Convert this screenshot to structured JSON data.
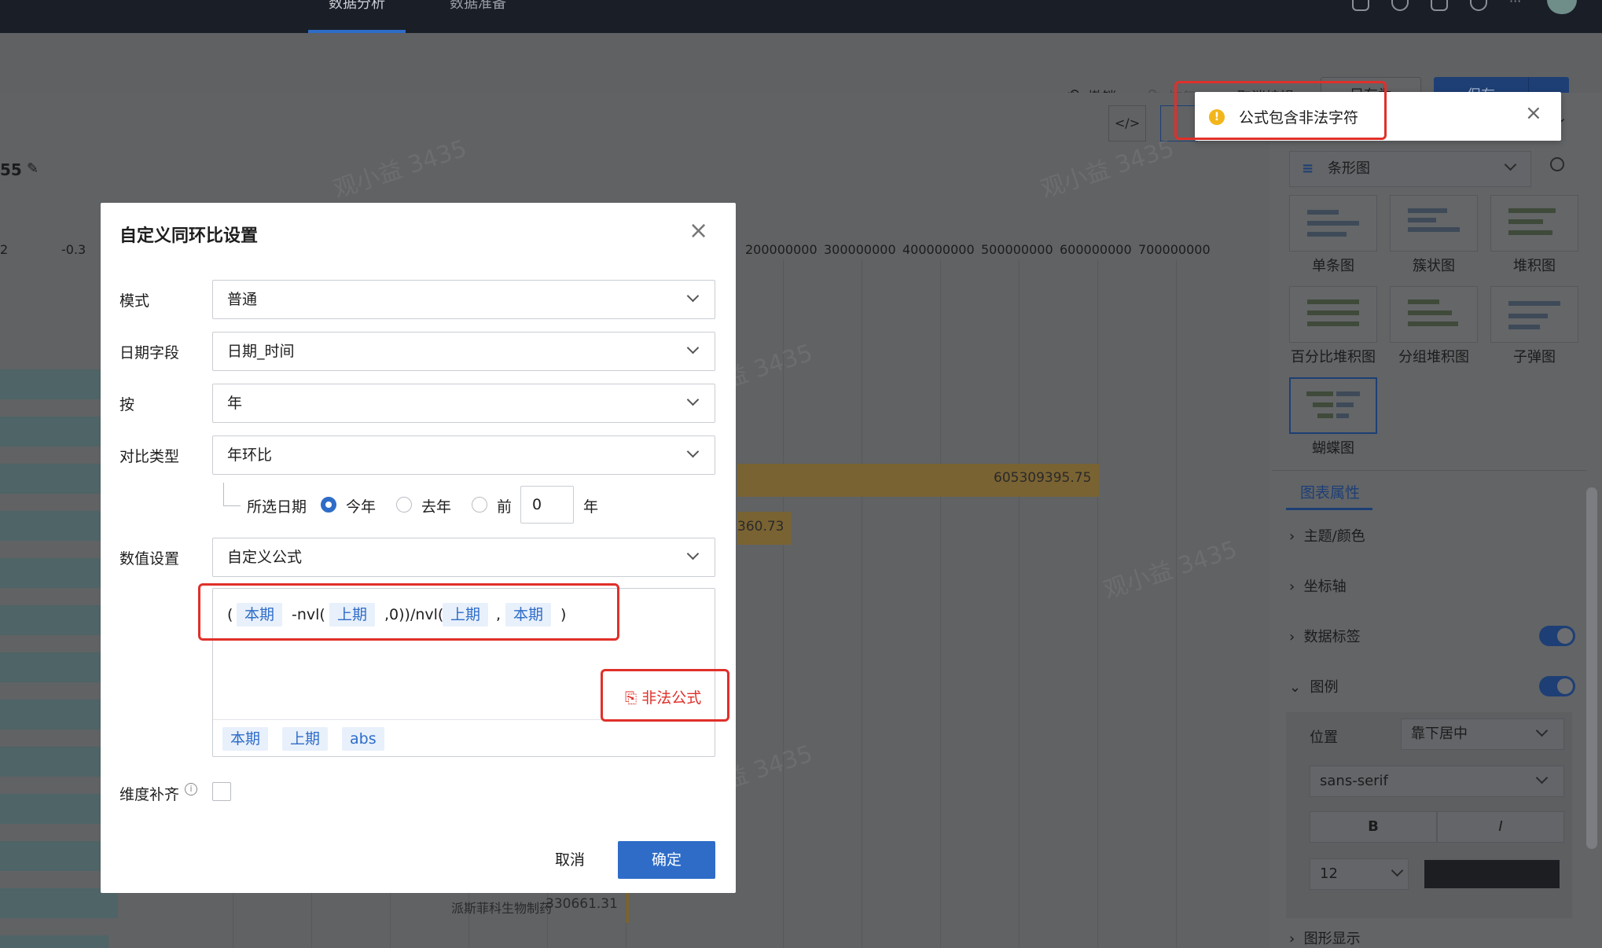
{
  "topbar": {
    "tabs": [
      "数据分析",
      "数据准备"
    ]
  },
  "toolbar": {
    "undo": "撤销",
    "redo": "恢复",
    "cancel_edit": "取消编辑",
    "save_as": "另存为",
    "save": "保存"
  },
  "chart": {
    "left_label": "55",
    "x_ticks": [
      "2",
      "-0.3",
      "200000000",
      "300000000",
      "400000000",
      "500000000",
      "600000000",
      "700000000"
    ],
    "bar_labels": [
      "605309395.75",
      "360.73",
      "派斯菲科生物制药",
      "330661.31"
    ]
  },
  "right_panel": {
    "chart_type": "条形图",
    "types": [
      "单条图",
      "簇状图",
      "堆积图",
      "百分比堆积图",
      "分组堆积图",
      "子弹图",
      "蝴蝶图"
    ],
    "tab": "图表属性",
    "sections": [
      "主题/颜色",
      "坐标轴",
      "数据标签",
      "图例",
      "图形显示"
    ],
    "legend_position_label": "位置",
    "legend_position": "靠下居中",
    "font_family": "sans-serif",
    "bold": "B",
    "italic": "I",
    "font_size": "12"
  },
  "notice": {
    "text": "公式包含非法字符"
  },
  "dialog": {
    "title": "自定义同环比设置",
    "mode_label": "模式",
    "mode_value": "普通",
    "date_field_label": "日期字段",
    "date_field_value": "日期_时间",
    "by_label": "按",
    "by_value": "年",
    "compare_label": "对比类型",
    "compare_value": "年环比",
    "selected_date_label": "所选日期",
    "radio_this_year": "今年",
    "radio_last_year": "去年",
    "radio_before": "前",
    "offset_value": "0",
    "offset_unit": "年",
    "value_setting_label": "数值设置",
    "value_setting_value": "自定义公式",
    "formula": {
      "open_paren": "(",
      "token1": "本期",
      "text1": "-nvl(",
      "token2": "上期",
      "text2": ",0))/nvl(",
      "token3": "上期",
      "comma": ",",
      "token4": "本期",
      "close_paren": ")"
    },
    "illegal_formula": "非法公式",
    "quick_tokens": [
      "本期",
      "上期",
      "abs"
    ],
    "dim_fill_label": "维度补齐",
    "cancel": "取消",
    "ok": "确定"
  }
}
